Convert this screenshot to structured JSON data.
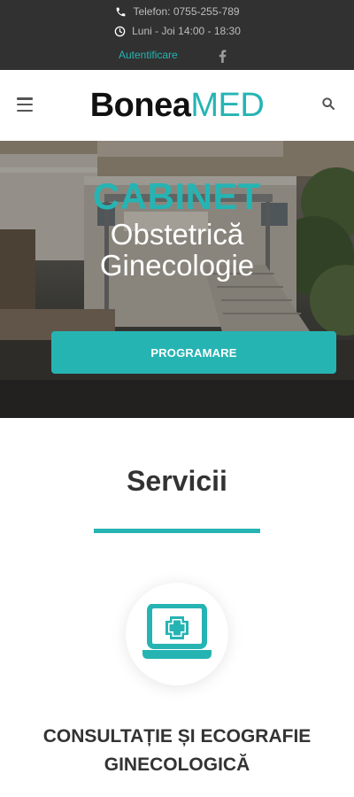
{
  "topbar": {
    "phone": "Telefon: 0755-255-789",
    "hours": "Luni - Joi 14:00 - 18:30",
    "login": "Autentificare",
    "phone_icon": "phone-icon",
    "clock_icon": "clock-icon",
    "social_icon": "facebook-icon"
  },
  "header": {
    "logo_part1": "Bonea",
    "logo_part2": "MED",
    "menu_icon": "hamburger-menu-icon",
    "search_icon": "search-icon"
  },
  "hero": {
    "title": "CABINET",
    "subtitle_line1": "Obstetrică",
    "subtitle_line2": "Ginecologie",
    "cta": "PROGRAMARE"
  },
  "services": {
    "heading": "Servicii",
    "items": [
      {
        "icon": "laptop-medical-icon",
        "title": "CONSULTAȚIE ȘI ECOGRAFIE GINECOLOGICĂ"
      }
    ]
  },
  "colors": {
    "accent": "#26b4b3",
    "topbar_bg": "#313131",
    "text_dark": "#333333"
  }
}
